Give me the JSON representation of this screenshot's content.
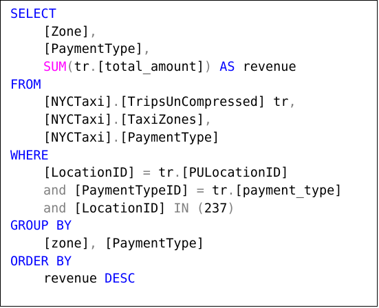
{
  "colors": {
    "keyword": "#0000ff",
    "function": "#ff00ff",
    "operator": "#808080",
    "text": "#000000"
  },
  "sql": {
    "l1": {
      "kw": "SELECT"
    },
    "l2": {
      "t": "[Zone]",
      "p": ","
    },
    "l3": {
      "t": "[PaymentType]",
      "p": ","
    },
    "l4": {
      "fn": "SUM",
      "o": "(",
      "t": "tr",
      "d": ".",
      "t2": "[total_amount]",
      "c": ")",
      "sp": " ",
      "kw": "AS",
      "t3": " revenue"
    },
    "l5": {
      "kw": "FROM"
    },
    "l6": {
      "t": "[NYCTaxi]",
      "d": ".",
      "t2": "[TripsUnCompressed] tr",
      "p": ","
    },
    "l7": {
      "t": "[NYCTaxi]",
      "d": ".",
      "t2": "[TaxiZones]",
      "p": ","
    },
    "l8": {
      "t": "[NYCTaxi]",
      "d": ".",
      "t2": "[PaymentType]"
    },
    "l9": {
      "kw": "WHERE"
    },
    "l10": {
      "t": "[LocationID] ",
      "eq": "=",
      "t2": " tr",
      "d": ".",
      "t3": "[PULocationID]"
    },
    "l11": {
      "and": "and",
      "t": " [PaymentTypeID] ",
      "eq": "=",
      "t2": " tr",
      "d": ".",
      "t3": "[payment_type]"
    },
    "l12": {
      "and": "and",
      "t": " [LocationID] ",
      "in": "IN",
      "sp": " ",
      "o": "(",
      "n": "237",
      "c": ")"
    },
    "l13": {
      "kw": "GROUP BY"
    },
    "l14": {
      "t": "[zone]",
      "p": ",",
      "t2": " [PaymentType]"
    },
    "l15": {
      "kw": "ORDER BY"
    },
    "l16": {
      "t": "revenue ",
      "kw": "DESC"
    }
  }
}
